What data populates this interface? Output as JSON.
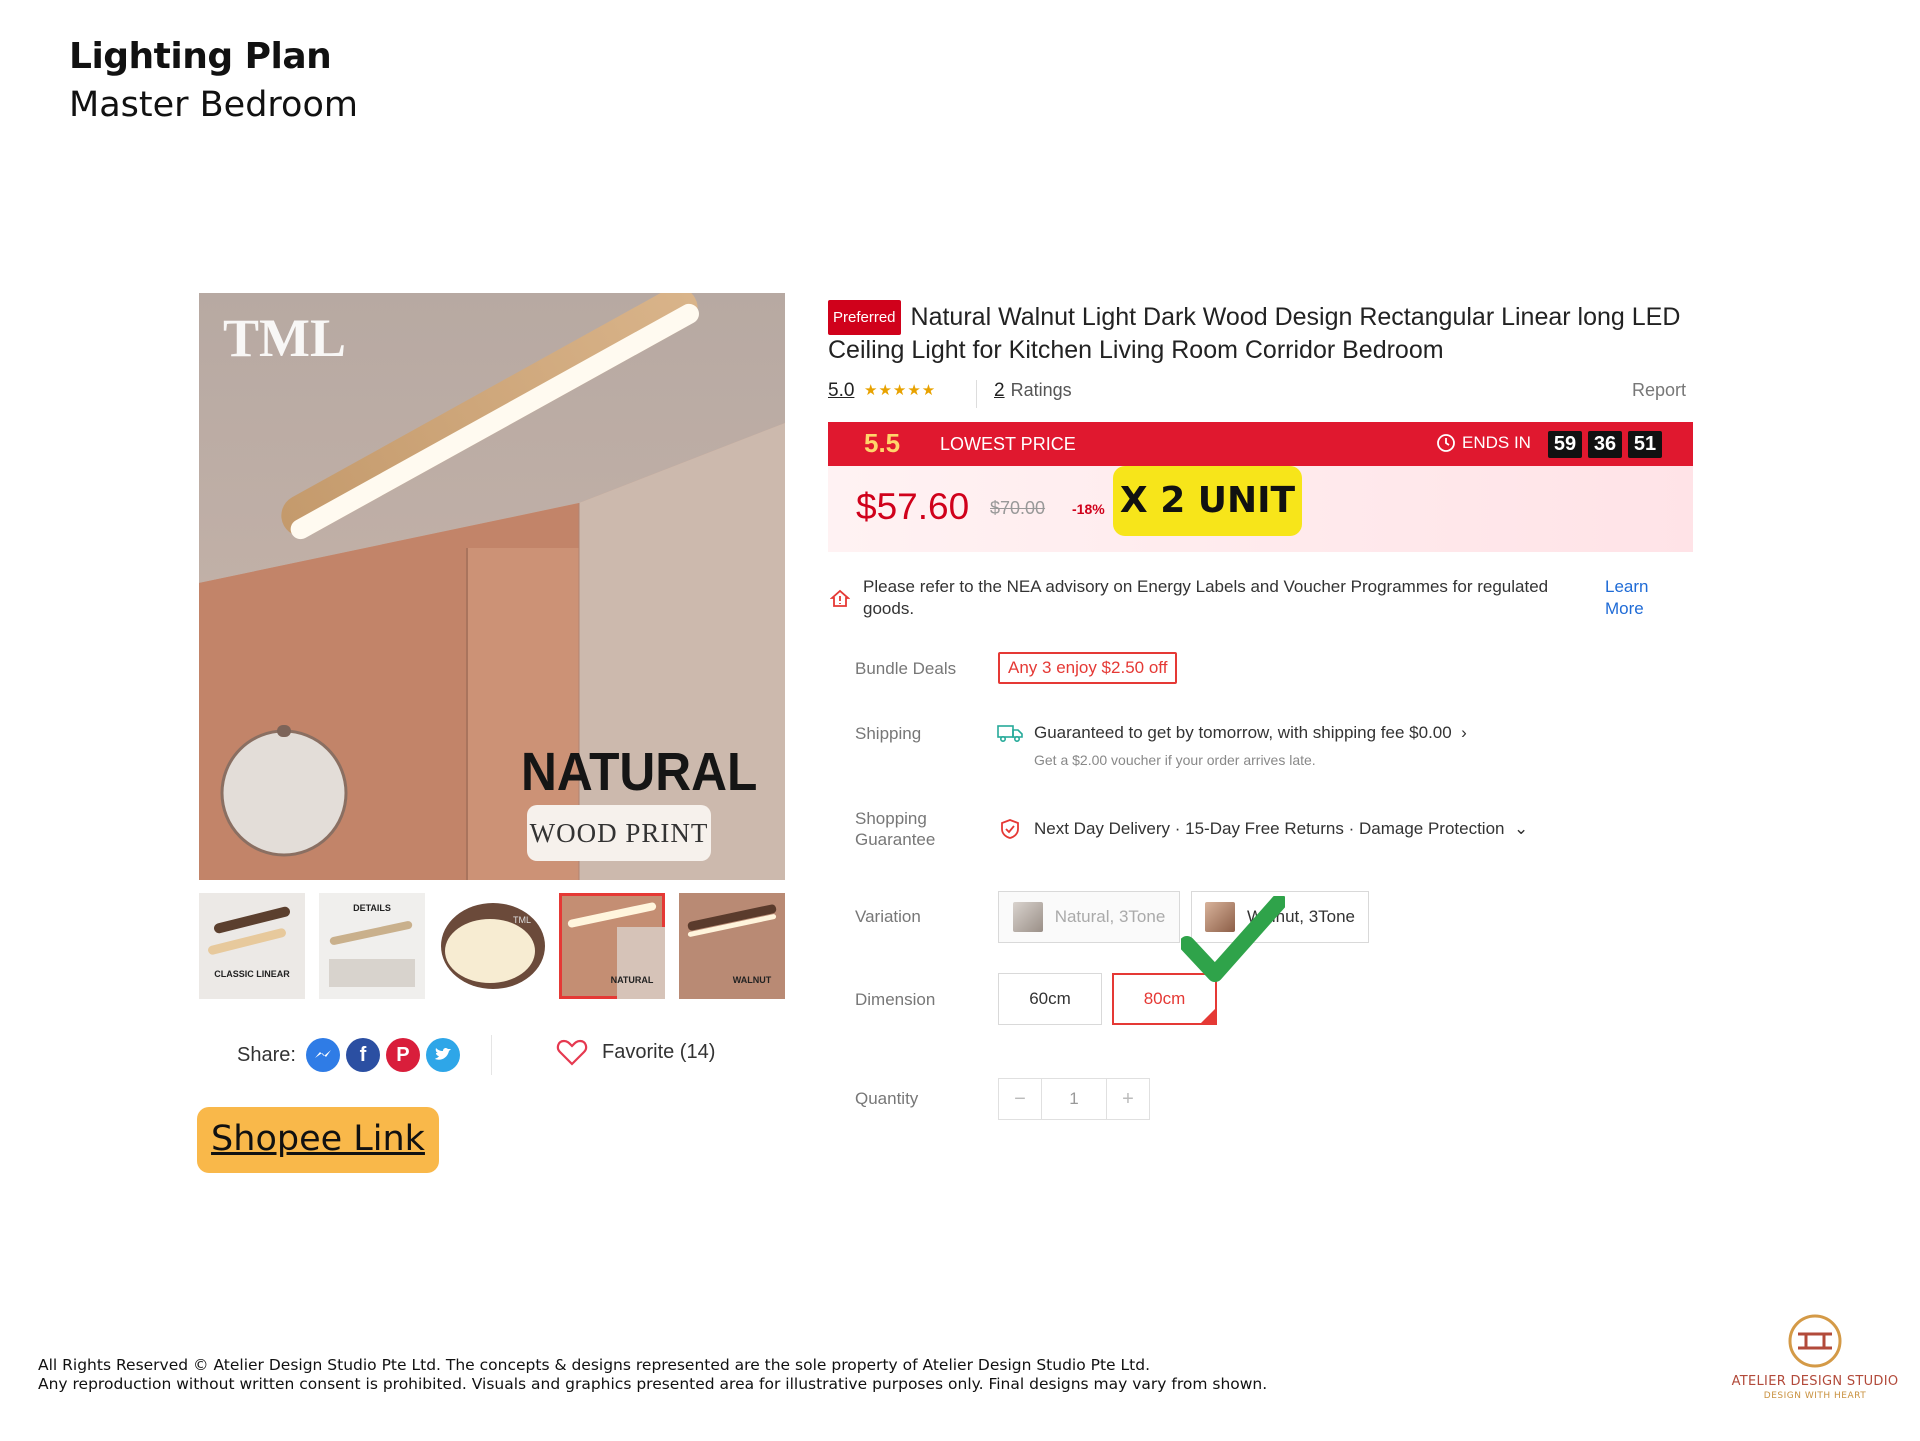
{
  "heading": {
    "title": "Lighting Plan",
    "subtitle": "Master Bedroom"
  },
  "product_image": {
    "brand": "TML",
    "headline": "NATURAL",
    "subline": "WOOD PRINT"
  },
  "thumbnails": [
    {
      "label": "CLASSIC LINEAR",
      "selected": false
    },
    {
      "label": "DETAILS",
      "selected": false
    },
    {
      "label": "TML",
      "selected": false
    },
    {
      "label": "NATURAL",
      "selected": true
    },
    {
      "label": "WALNUT",
      "selected": false
    }
  ],
  "share": {
    "label": "Share:",
    "icons": [
      "messenger-icon",
      "facebook-icon",
      "pinterest-icon",
      "twitter-icon"
    ]
  },
  "favorite": {
    "label": "Favorite (14)"
  },
  "shopee_link": "Shopee Link",
  "product": {
    "badge": "Preferred",
    "title": "Natural Walnut Light Dark Wood Design Rectangular Linear long LED Ceiling Light for Kitchen Living Room Corridor Bedroom",
    "rating": "5.0",
    "stars": "★★★★★",
    "rating_count": "2",
    "rating_label": "Ratings",
    "report": "Report"
  },
  "flash_sale": {
    "event": "5.5",
    "label": "LOWEST PRICE",
    "ends_label": "ENDS IN",
    "timer": [
      "59",
      "36",
      "51"
    ]
  },
  "price": {
    "current": "$57.60",
    "original": "$70.00",
    "discount": "-18%"
  },
  "unit_note": "X 2 UNIT",
  "advisory": {
    "text": "Please refer to the NEA advisory on Energy Labels and Voucher Programmes for regulated goods.",
    "link": "Learn More"
  },
  "bundle": {
    "label": "Bundle Deals",
    "deal": "Any 3 enjoy $2.50 off"
  },
  "shipping": {
    "label": "Shipping",
    "text": "Guaranteed to get by tomorrow, with shipping fee $0.00",
    "chevron": "›",
    "sub": "Get a $2.00 voucher if your order arrives late."
  },
  "guarantee": {
    "label": "Shopping Guarantee",
    "text": "Next Day Delivery · 15-Day Free Returns · Damage Protection",
    "chevron": "⌄"
  },
  "variation": {
    "label": "Variation",
    "options": [
      {
        "label": "Natural, 3Tone",
        "state": "disabled"
      },
      {
        "label": "Walnut, 3Tone",
        "state": "normal"
      }
    ]
  },
  "dimension": {
    "label": "Dimension",
    "options": [
      {
        "label": "60cm",
        "state": "normal"
      },
      {
        "label": "80cm",
        "state": "selected"
      }
    ]
  },
  "quantity": {
    "label": "Quantity",
    "minus": "−",
    "value": "1",
    "plus": "+"
  },
  "footer": {
    "line1": "All Rights Reserved © Atelier Design Studio Pte Ltd. The concepts & designs represented are the sole property of Atelier Design Studio Pte Ltd.",
    "line2": "Any reproduction without written consent is prohibited. Visuals and graphics presented area for illustrative purposes only. Final designs may vary from shown."
  },
  "logo": {
    "name": "ATELIER DESIGN STUDIO",
    "tagline": "DESIGN WITH HEART"
  },
  "colors": {
    "accent_red": "#d0011b",
    "shopee_button": "#f9b84a",
    "unit_highlight": "#f7e51a",
    "check_green": "#2fa34a"
  }
}
